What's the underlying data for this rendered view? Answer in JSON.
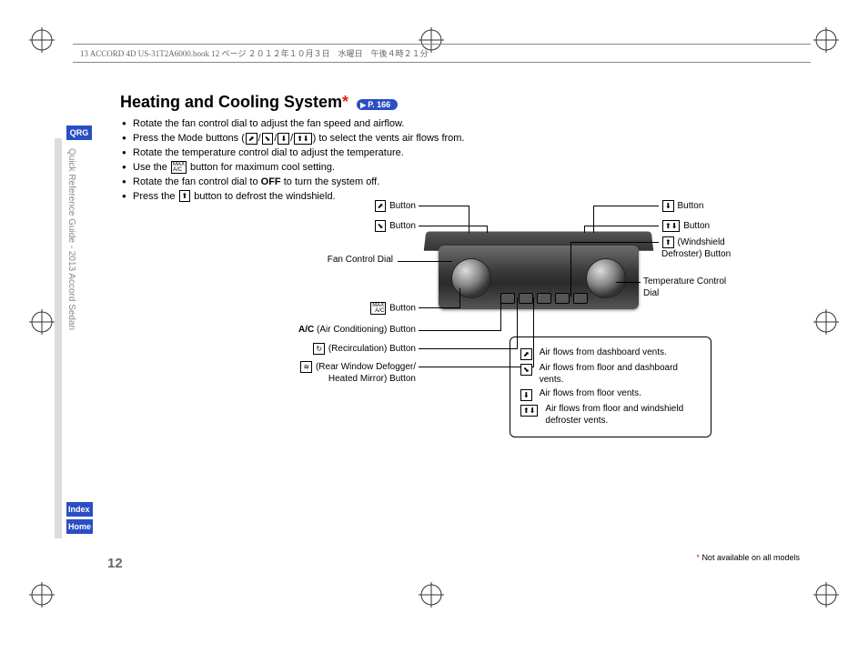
{
  "header": "13 ACCORD 4D US-31T2A6000.book  12 ページ  ２０１２年１０月３日　水曜日　午後４時２１分",
  "sidebar": {
    "qrg": "QRG",
    "title": "Quick Reference Guide - 2013 Accord Sedan",
    "index": "Index",
    "home": "Home"
  },
  "page_number": "12",
  "title": "Heating and Cooling System",
  "title_star": "*",
  "page_ref": "P. 166",
  "instructions": [
    {
      "pre": "Rotate the fan control dial to adjust the fan speed and airflow."
    },
    {
      "pre": "Press the Mode buttons (",
      "icons": [
        "⬈",
        "⬊",
        "⬇",
        "⬆⬇"
      ],
      "post": ") to select the vents air flows from."
    },
    {
      "pre": "Rotate the temperature control dial to adjust the temperature."
    },
    {
      "pre": "Use the ",
      "icons": [
        "MAX A/C"
      ],
      "post": " button for maximum cool setting."
    },
    {
      "pre": "Rotate the fan control dial to ",
      "bold": "OFF",
      "post2": " to turn the system off."
    },
    {
      "pre": "Press the ",
      "icons": [
        "⬆"
      ],
      "post": " button to defrost the windshield."
    }
  ],
  "labels": {
    "tl1": "Button",
    "tl2": "Button",
    "fan_dial": "Fan Control Dial",
    "max_btn": "Button",
    "ac": "(Air Conditioning) Button",
    "ac_pre": "A/C",
    "recirc": "(Recirculation) Button",
    "rear": "(Rear Window Defogger/ Heated Mirror) Button",
    "tr1": "Button",
    "tr2": "Button",
    "wind": "(Windshield Defroster) Button",
    "temp_dial": "Temperature Control Dial"
  },
  "legend": [
    "Air flows from dashboard vents.",
    "Air flows from floor and dashboard vents.",
    "Air flows from floor vents.",
    "Air flows from floor and windshield defroster vents."
  ],
  "footnote": "Not available on all models"
}
